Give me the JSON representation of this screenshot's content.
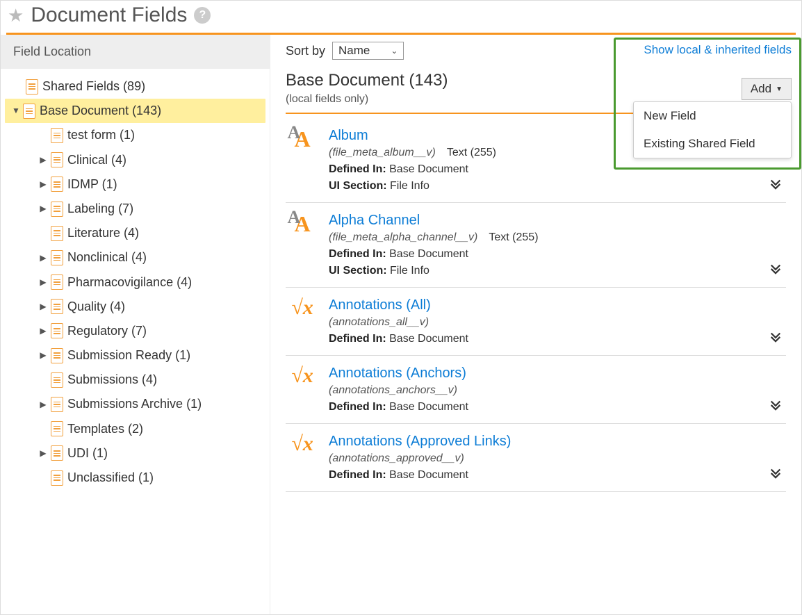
{
  "header": {
    "title": "Document Fields"
  },
  "sidebar": {
    "title": "Field Location",
    "shared": {
      "label": "Shared Fields",
      "count": 89
    },
    "base": {
      "label": "Base Document",
      "count": 143
    },
    "items": [
      {
        "label": "test form",
        "count": 1,
        "expandable": false
      },
      {
        "label": "Clinical",
        "count": 4,
        "expandable": true
      },
      {
        "label": "IDMP",
        "count": 1,
        "expandable": true
      },
      {
        "label": "Labeling",
        "count": 7,
        "expandable": true
      },
      {
        "label": "Literature",
        "count": 4,
        "expandable": false
      },
      {
        "label": "Nonclinical",
        "count": 4,
        "expandable": true
      },
      {
        "label": "Pharmacovigilance",
        "count": 4,
        "expandable": true
      },
      {
        "label": "Quality",
        "count": 4,
        "expandable": true
      },
      {
        "label": "Regulatory",
        "count": 7,
        "expandable": true
      },
      {
        "label": "Submission Ready",
        "count": 1,
        "expandable": true
      },
      {
        "label": "Submissions",
        "count": 4,
        "expandable": false
      },
      {
        "label": "Submissions Archive",
        "count": 1,
        "expandable": true
      },
      {
        "label": "Templates",
        "count": 2,
        "expandable": false
      },
      {
        "label": "UDI",
        "count": 1,
        "expandable": true
      },
      {
        "label": "Unclassified",
        "count": 1,
        "expandable": false
      }
    ]
  },
  "main": {
    "sort_label": "Sort by",
    "sort_value": "Name",
    "toggle_link": "Show local & inherited fields",
    "title": "Base Document (143)",
    "subtitle": "(local fields only)",
    "add_label": "Add",
    "dropdown": {
      "new_field": "New Field",
      "existing": "Existing Shared Field"
    },
    "defined_in_label": "Defined In:",
    "ui_section_label": "UI Section:",
    "fields": [
      {
        "name": "Album",
        "api": "(file_meta_album__v)",
        "type": "Text (255)",
        "defined_in": "Base Document",
        "ui_section": "File Info",
        "icon": "text"
      },
      {
        "name": "Alpha Channel",
        "api": "(file_meta_alpha_channel__v)",
        "type": "Text (255)",
        "defined_in": "Base Document",
        "ui_section": "File Info",
        "icon": "text"
      },
      {
        "name": "Annotations (All)",
        "api": "(annotations_all__v)",
        "type": "",
        "defined_in": "Base Document",
        "ui_section": "",
        "icon": "formula"
      },
      {
        "name": "Annotations (Anchors)",
        "api": "(annotations_anchors__v)",
        "type": "",
        "defined_in": "Base Document",
        "ui_section": "",
        "icon": "formula"
      },
      {
        "name": "Annotations (Approved Links)",
        "api": "(annotations_approved__v)",
        "type": "",
        "defined_in": "Base Document",
        "ui_section": "",
        "icon": "formula"
      }
    ]
  }
}
